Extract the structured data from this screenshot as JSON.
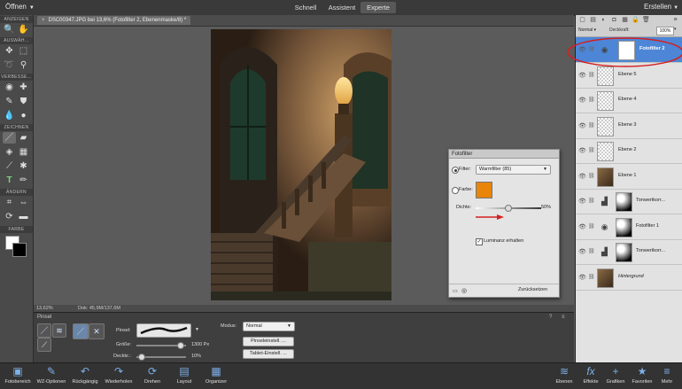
{
  "topbar": {
    "open_label": "Öffnen",
    "modes": [
      "Schnell",
      "Assistent",
      "Experte"
    ],
    "create_label": "Erstellen"
  },
  "toolbar": {
    "sections": [
      "ANZEIGEN",
      "AUSWÄH...",
      "VERBESSE...",
      "ZEICHNEN",
      "ÄNDERN",
      "FARBE"
    ]
  },
  "document": {
    "tab_title": "DSC00347.JPG bei 13,6% (Fotofilter 2, Ebenenmaske/8) *"
  },
  "status": {
    "zoom": "13,62%",
    "doc_size": "Dok: 45,9M/137,6M"
  },
  "options": {
    "title": "Pinsel",
    "brush_label": "Pinsel:",
    "size_label": "Größe:",
    "size_value": "1300 Px",
    "size_level": 0.9,
    "opacity_label": "Deckkr.:",
    "opacity_value": "10%",
    "opacity_level": 0.1,
    "mode_label": "Modus:",
    "mode_value": "Normal",
    "brush_settings_button": "Pinseleinstell. ...",
    "tablet_settings_button": "Tablet-Einstell. ..."
  },
  "layers_panel": {
    "blend_mode": "Normal",
    "opacity_label": "Deckkraft:",
    "opacity_value": "100%",
    "layers": [
      {
        "name": "Fotofilter 2",
        "selected": true,
        "kind": "adjustment"
      },
      {
        "name": "Ebene 5",
        "kind": "empty"
      },
      {
        "name": "Ebene 4",
        "kind": "empty"
      },
      {
        "name": "Ebene 3",
        "kind": "empty"
      },
      {
        "name": "Ebene 2",
        "kind": "empty"
      },
      {
        "name": "Ebene 1",
        "kind": "photo"
      },
      {
        "name": "Tonwertkorr...",
        "kind": "levels"
      },
      {
        "name": "Fotofilter 1",
        "kind": "adjustment"
      },
      {
        "name": "Tonwertkorr...",
        "kind": "levels"
      },
      {
        "name": "Hintergrund",
        "kind": "photo",
        "italic": true
      }
    ]
  },
  "dialog": {
    "title": "Fotofilter",
    "filter_label": "Filter:",
    "filter_value": "Warmfilter (85)",
    "color_label": "Farbe:",
    "color_value": "#e8850a",
    "density_label": "Dichte:",
    "density_value": "50%",
    "density_level": 0.5,
    "luminance_label": "Luminanz erhalten",
    "reset_button": "Zurücksetzen"
  },
  "taskbar": {
    "left": [
      {
        "label": "Fotobereich",
        "icon": "photo-bin-icon"
      },
      {
        "label": "WZ-Optionen",
        "icon": "tool-options-icon"
      },
      {
        "label": "Rückgängig",
        "icon": "undo-icon"
      },
      {
        "label": "Wiederholen",
        "icon": "redo-icon"
      },
      {
        "label": "Drehen",
        "icon": "rotate-icon"
      },
      {
        "label": "Layout",
        "icon": "layout-icon"
      },
      {
        "label": "Organizer",
        "icon": "organizer-icon"
      }
    ],
    "right": [
      {
        "label": "Ebenen",
        "icon": "layers-icon"
      },
      {
        "label": "Effekte",
        "icon": "fx-icon"
      },
      {
        "label": "Grafiken",
        "icon": "plus-icon"
      },
      {
        "label": "Favoriten",
        "icon": "star-icon"
      },
      {
        "label": "Mehr",
        "icon": "more-icon"
      }
    ]
  },
  "colors": {
    "highlight_circle": "#d42020",
    "selected_layer": "#4d86d6"
  }
}
